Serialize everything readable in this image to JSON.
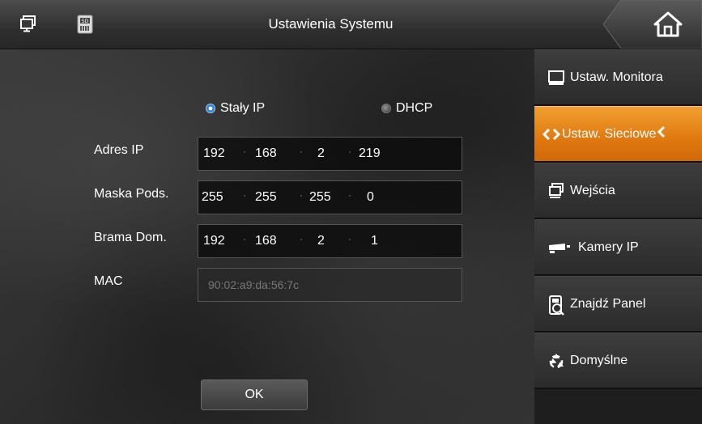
{
  "header": {
    "title": "Ustawienia Systemu",
    "left_icons": [
      "monitor-copy-icon",
      "sd-card-icon"
    ],
    "home_icon": "home-icon"
  },
  "network": {
    "mode_options": [
      {
        "label": "Stały IP",
        "selected": true
      },
      {
        "label": "DHCP",
        "selected": false
      }
    ],
    "fields": [
      {
        "label": "Adres IP",
        "octets": [
          "192",
          "168",
          "2",
          "219"
        ]
      },
      {
        "label": "Maska Pods.",
        "octets": [
          "255",
          "255",
          "255",
          "0"
        ]
      },
      {
        "label": "Brama Dom.",
        "octets": [
          "192",
          "168",
          "2",
          "1"
        ]
      }
    ],
    "mac": {
      "label": "MAC",
      "value": "90:02:a9:da:56:7c"
    },
    "ok_label": "OK"
  },
  "sidebar": {
    "items": [
      {
        "label": "Ustaw. Monitora",
        "icon": "monitor-icon",
        "active": false
      },
      {
        "label": "Ustaw. Sieciowe",
        "icon": "network-arrows-icon",
        "active": true
      },
      {
        "label": "Wejścia",
        "icon": "inputs-icon",
        "active": false
      },
      {
        "label": "Kamery IP",
        "icon": "camera-icon",
        "active": false
      },
      {
        "label": "Znajdź Panel",
        "icon": "find-panel-icon",
        "active": false
      },
      {
        "label": "Domyślne",
        "icon": "recycle-icon",
        "active": false
      }
    ],
    "active_color": "#e67d10"
  }
}
